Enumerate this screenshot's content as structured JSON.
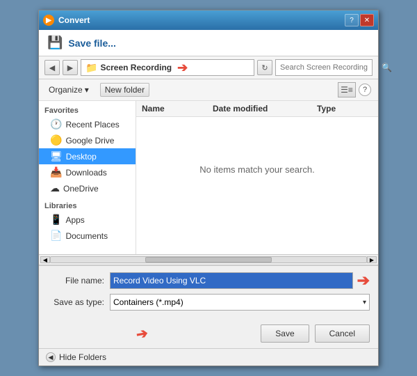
{
  "window": {
    "title": "Convert",
    "title_btn_help": "?",
    "title_btn_close": "✕"
  },
  "save_header": {
    "icon": "💾",
    "title": "Save file..."
  },
  "nav": {
    "back_tooltip": "Back",
    "forward_tooltip": "Forward",
    "folder_icon": "📁",
    "breadcrumb": "Screen Recording",
    "refresh_label": "↻",
    "search_placeholder": "Search Screen Recording",
    "search_icon": "🔍"
  },
  "toolbar": {
    "organize_label": "Organize",
    "organize_chevron": "▾",
    "new_folder_label": "New folder",
    "view_icon": "☰",
    "view_split": "≡",
    "help_label": "?"
  },
  "file_list": {
    "columns": [
      "Name",
      "Date modified",
      "Type"
    ],
    "empty_message": "No items match your search.",
    "items": []
  },
  "form": {
    "filename_label": "File name:",
    "filename_value": "Record Video Using VLC",
    "savetype_label": "Save as type:",
    "savetype_value": "Containers (*.mp4)"
  },
  "buttons": {
    "save_label": "Save",
    "cancel_label": "Cancel"
  },
  "footer": {
    "hide_folders_label": "Hide Folders"
  },
  "sidebar": {
    "favorites_header": "Favorites",
    "items_favorites": [
      {
        "icon": "⭐",
        "label": "Recent Places"
      },
      {
        "icon": "🟡",
        "label": "Google Drive"
      },
      {
        "icon": "🖥",
        "label": "Desktop"
      },
      {
        "icon": "📥",
        "label": "Downloads"
      },
      {
        "icon": "☁",
        "label": "OneDrive"
      }
    ],
    "libraries_header": "Libraries",
    "items_libraries": [
      {
        "icon": "📱",
        "label": "Apps"
      },
      {
        "icon": "📄",
        "label": "Documents"
      }
    ]
  }
}
